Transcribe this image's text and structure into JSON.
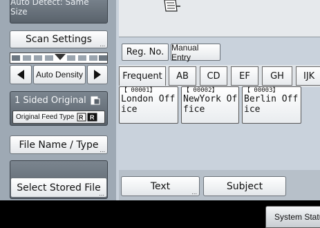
{
  "left": {
    "top_label": "Auto Detect: Same Size",
    "scan_settings": "Scan Settings",
    "auto_density": "Auto Density",
    "sided_original": "1 Sided Original",
    "feed_type": "Original Feed Type",
    "file_name_type": "File Name / Type",
    "select_stored_file": "Select Stored File"
  },
  "main": {
    "reg_no": "Reg. No.",
    "manual_entry": "Manual Entry",
    "tabs": [
      "Frequent",
      "AB",
      "CD",
      "EF",
      "GH",
      "IJK"
    ],
    "destinations": [
      {
        "id": "【 00001】",
        "line1": "London Off",
        "line2": "ice"
      },
      {
        "id": "【 00002】",
        "line1": "NewYork Of",
        "line2": "fice"
      },
      {
        "id": "【 00003】",
        "line1": "Berlin Off",
        "line2": "ice"
      }
    ],
    "text_label": "Text",
    "subject_label": "Subject"
  },
  "footer": {
    "system_status": "System Status"
  },
  "icons": {
    "document": "document-icon",
    "left_arrow": "left-arrow-icon",
    "right_arrow": "right-arrow-icon",
    "sided": "sided-original-icon",
    "feed": "feed-type-icon"
  }
}
